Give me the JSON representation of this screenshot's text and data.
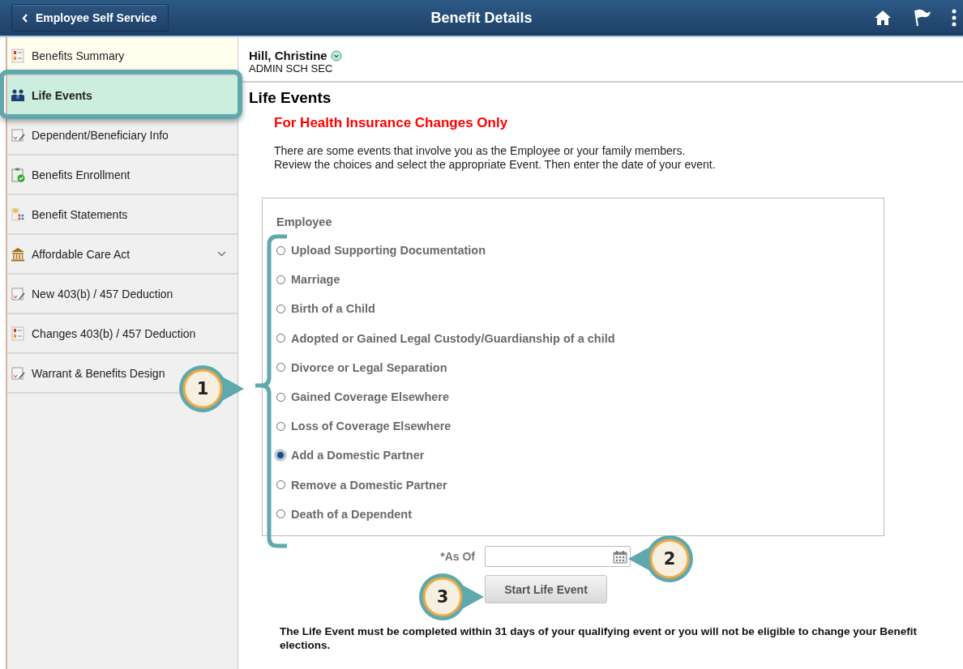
{
  "header": {
    "back_button": "Employee Self Service",
    "title": "Benefit Details"
  },
  "sidebar": {
    "items": [
      {
        "label": "Benefits Summary",
        "kind": "link",
        "selected": false
      },
      {
        "label": "Life Events",
        "kind": "link",
        "selected": true
      },
      {
        "label": "Dependent/Beneficiary Info",
        "kind": "link",
        "selected": false
      },
      {
        "label": "Benefits Enrollment",
        "kind": "link",
        "selected": false
      },
      {
        "label": "Benefit Statements",
        "kind": "link",
        "selected": false
      },
      {
        "label": "Affordable Care Act",
        "kind": "group",
        "selected": false
      },
      {
        "label": "New 403(b) / 457 Deduction",
        "kind": "link",
        "selected": false
      },
      {
        "label": "Changes 403(b) / 457 Deduction",
        "kind": "link",
        "selected": false
      },
      {
        "label": "Warrant & Benefits Design",
        "kind": "link",
        "selected": false
      }
    ]
  },
  "employee": {
    "name": "Hill, Christine",
    "job": "ADMIN SCH SEC"
  },
  "page_title": "Life Events",
  "notice": "For Health Insurance Changes Only",
  "instructions": [
    "There are some events that involve you as the Employee or your family members.",
    "Review the choices and select the appropriate Event. Then enter the date of your event."
  ],
  "events": {
    "group_label": "Employee",
    "options": [
      {
        "label": "Upload Supporting Documentation",
        "selected": false
      },
      {
        "label": "Marriage",
        "selected": false
      },
      {
        "label": "Birth of a Child",
        "selected": false
      },
      {
        "label": "Adopted or Gained Legal Custody/Guardianship of a child",
        "selected": false
      },
      {
        "label": "Divorce or Legal Separation",
        "selected": false
      },
      {
        "label": "Gained Coverage Elsewhere",
        "selected": false
      },
      {
        "label": "Loss of Coverage Elsewhere",
        "selected": false
      },
      {
        "label": "Add a Domestic Partner",
        "selected": true
      },
      {
        "label": "Remove a Domestic Partner",
        "selected": false
      },
      {
        "label": "Death of a Dependent",
        "selected": false
      }
    ]
  },
  "as_of": {
    "label": "*As Of"
  },
  "start_button": "Start Life Event",
  "footnote": "The Life Event must be completed within 31 days of your qualifying event or you will not be eligible to change your Benefit elections.",
  "callouts": [
    {
      "label": "1"
    },
    {
      "label": "2"
    },
    {
      "label": "3"
    }
  ]
}
